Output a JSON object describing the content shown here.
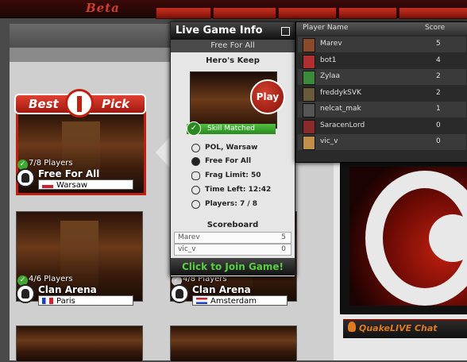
{
  "header": {
    "beta_label": "Beta"
  },
  "best_pick": {
    "best": "Best",
    "pick": "Pick"
  },
  "cards": [
    {
      "players": "7/8 Players",
      "mode": "Free For All",
      "location": "Warsaw"
    },
    {
      "players": "4/6 Players",
      "mode": "Clan Arena",
      "location": "Paris"
    },
    {
      "players": "4/8 Players",
      "mode": "Clan Arena",
      "location": "Amsterdam"
    }
  ],
  "popup": {
    "title": "Live Game Info",
    "subtitle": "Free For All",
    "map": "Hero's Keep",
    "play": "Play",
    "skill": "Skill Matched",
    "details": {
      "location": "POL, Warsaw",
      "mode": "Free For All",
      "frag": "Frag Limit: 50",
      "time": "Time Left: 12:42",
      "players": "Players: 7 / 8"
    },
    "scoreboard_label": "Scoreboard",
    "scoreboard": [
      {
        "name": "Marev",
        "score": "5"
      },
      {
        "name": "vic_v",
        "score": "0"
      }
    ],
    "join": "Click to Join Game!"
  },
  "player_list": {
    "col_name": "Player Name",
    "col_score": "Score",
    "rows": [
      {
        "name": "Marev",
        "score": "5",
        "color": "#8a4a2a"
      },
      {
        "name": "bot1",
        "score": "4",
        "color": "#b03030"
      },
      {
        "name": "Zylaa",
        "score": "2",
        "color": "#3a8a3a"
      },
      {
        "name": "freddykSVK",
        "score": "2",
        "color": "#6a5a3a"
      },
      {
        "name": "nelcat_mak",
        "score": "1",
        "color": "#555555"
      },
      {
        "name": "SaracenLord",
        "score": "0",
        "color": "#8a2a2a"
      },
      {
        "name": "vic_v",
        "score": "0",
        "color": "#c0904a"
      }
    ]
  },
  "chat": {
    "label": "QuakeLIVE Chat"
  }
}
